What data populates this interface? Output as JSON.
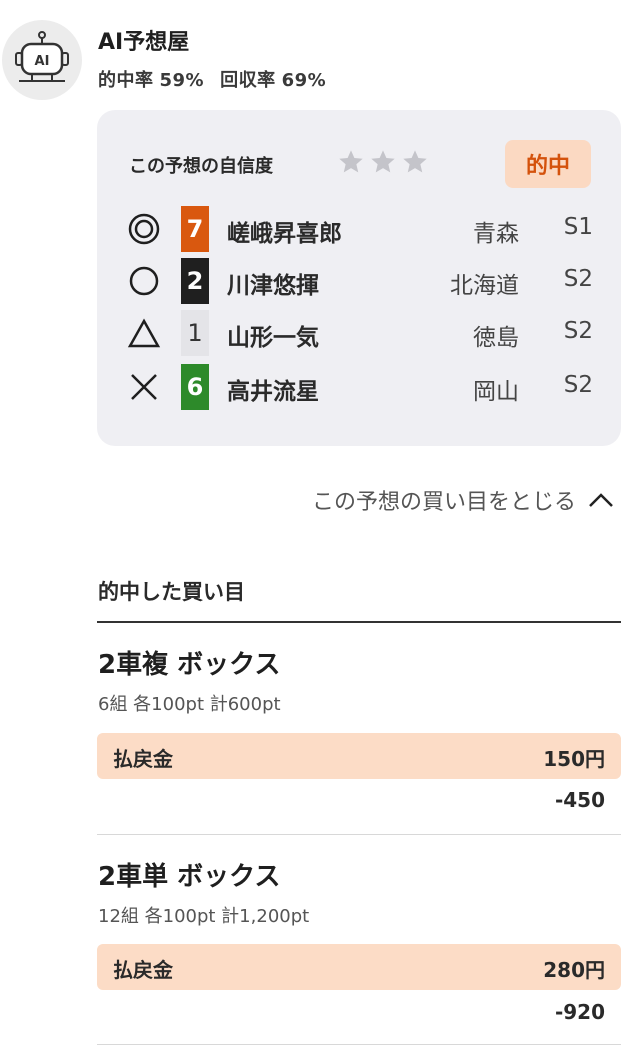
{
  "predictor": {
    "name": "AI予想屋",
    "hit_rate_label": "的中率",
    "hit_rate": "59%",
    "recovery_label": "回収率",
    "recovery": "69%",
    "avatar_text": "AI"
  },
  "prediction": {
    "confidence_label": "この予想の自信度",
    "confidence_stars": 0,
    "confidence_max": 3,
    "result_badge": "的中",
    "colors": {
      "badge_bg": "#fbd9c2",
      "badge_text": "#d4520c",
      "card_bg": "#efeff3"
    },
    "racers": [
      {
        "mark": "double-circle",
        "number": "7",
        "number_color": "#d9580f",
        "number_text_color": "#ffffff",
        "name": "嵯峨昇喜郎",
        "prefecture": "青森",
        "grade": "S1"
      },
      {
        "mark": "circle",
        "number": "2",
        "number_color": "#1f1f1f",
        "number_text_color": "#ffffff",
        "name": "川津悠揮",
        "prefecture": "北海道",
        "grade": "S2"
      },
      {
        "mark": "triangle",
        "number": "1",
        "number_color": "#e4e4e8",
        "number_text_color": "#333333",
        "name": "山形一気",
        "prefecture": "徳島",
        "grade": "S2"
      },
      {
        "mark": "cross",
        "number": "6",
        "number_color": "#2d8a2a",
        "number_text_color": "#ffffff",
        "name": "高井流星",
        "prefecture": "岡山",
        "grade": "S2"
      }
    ]
  },
  "toggle": {
    "label": "この予想の買い目をとじる"
  },
  "bets_section": {
    "title": "的中した買い目",
    "bets": [
      {
        "type": "2車複 ボックス",
        "detail": "6組 各100pt 計600pt",
        "payout_label": "払戻金",
        "payout": "150円",
        "balance": "-450"
      },
      {
        "type": "2車単 ボックス",
        "detail": "12組 各100pt 計1,200pt",
        "payout_label": "払戻金",
        "payout": "280円",
        "balance": "-920"
      }
    ]
  }
}
